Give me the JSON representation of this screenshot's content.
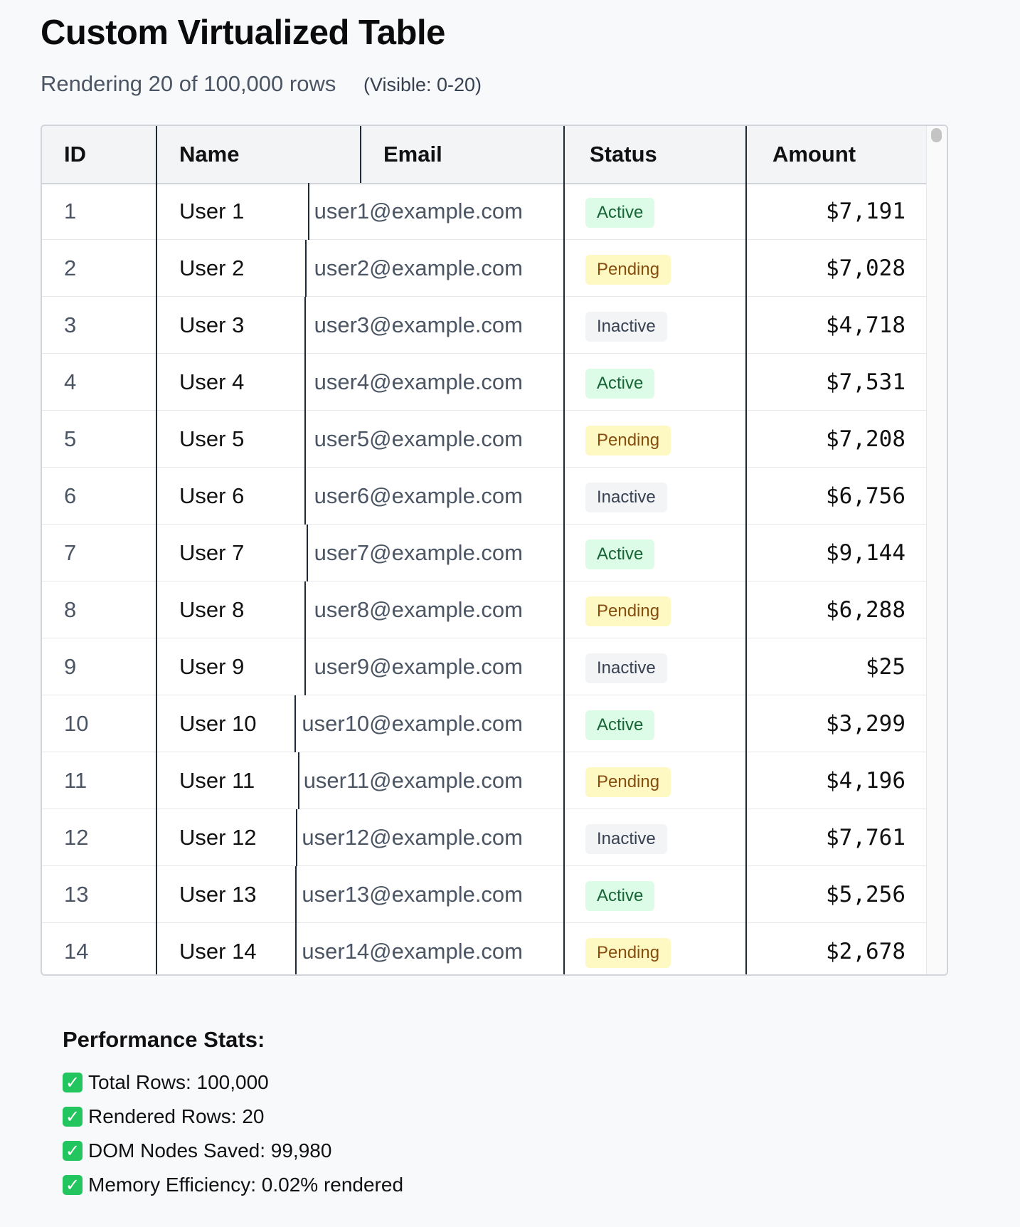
{
  "page": {
    "title": "Custom Virtualized Table",
    "subtitle": "Rendering 20 of 100,000 rows",
    "visible_range": "(Visible: 0-20)"
  },
  "table": {
    "columns": [
      "ID",
      "Name",
      "Email",
      "Status",
      "Amount"
    ],
    "rows": [
      {
        "id": "1",
        "name": "User 1",
        "email": "user1@example.com",
        "status": "Active",
        "amount": "$7,191"
      },
      {
        "id": "2",
        "name": "User 2",
        "email": "user2@example.com",
        "status": "Pending",
        "amount": "$7,028"
      },
      {
        "id": "3",
        "name": "User 3",
        "email": "user3@example.com",
        "status": "Inactive",
        "amount": "$4,718"
      },
      {
        "id": "4",
        "name": "User 4",
        "email": "user4@example.com",
        "status": "Active",
        "amount": "$7,531"
      },
      {
        "id": "5",
        "name": "User 5",
        "email": "user5@example.com",
        "status": "Pending",
        "amount": "$7,208"
      },
      {
        "id": "6",
        "name": "User 6",
        "email": "user6@example.com",
        "status": "Inactive",
        "amount": "$6,756"
      },
      {
        "id": "7",
        "name": "User 7",
        "email": "user7@example.com",
        "status": "Active",
        "amount": "$9,144"
      },
      {
        "id": "8",
        "name": "User 8",
        "email": "user8@example.com",
        "status": "Pending",
        "amount": "$6,288"
      },
      {
        "id": "9",
        "name": "User 9",
        "email": "user9@example.com",
        "status": "Inactive",
        "amount": "$25"
      },
      {
        "id": "10",
        "name": "User 10",
        "email": "user10@example.com",
        "status": "Active",
        "amount": "$3,299"
      },
      {
        "id": "11",
        "name": "User 11",
        "email": "user11@example.com",
        "status": "Pending",
        "amount": "$4,196"
      },
      {
        "id": "12",
        "name": "User 12",
        "email": "user12@example.com",
        "status": "Inactive",
        "amount": "$7,761"
      },
      {
        "id": "13",
        "name": "User 13",
        "email": "user13@example.com",
        "status": "Active",
        "amount": "$5,256"
      },
      {
        "id": "14",
        "name": "User 14",
        "email": "user14@example.com",
        "status": "Pending",
        "amount": "$2,678"
      }
    ]
  },
  "stats": {
    "title": "Performance Stats:",
    "items": [
      "Total Rows: 100,000",
      "Rendered Rows: 20",
      "DOM Nodes Saved: 99,980",
      "Memory Efficiency: 0.02% rendered"
    ]
  },
  "colors": {
    "active_bg": "#dcfce7",
    "active_text": "#166534",
    "pending_bg": "#fef9c3",
    "pending_text": "#854d0e",
    "inactive_bg": "#f3f4f6",
    "inactive_text": "#374151",
    "check_green": "#22c55e"
  },
  "icons": {
    "stat_check": "check-mark-icon"
  }
}
